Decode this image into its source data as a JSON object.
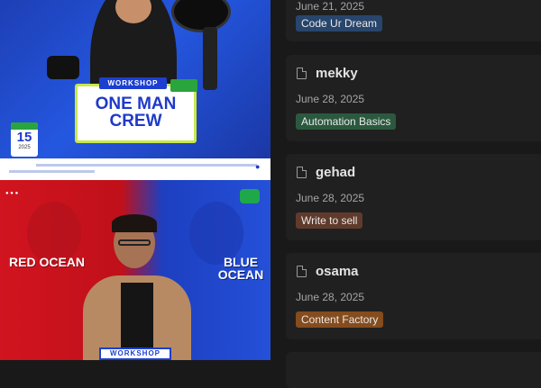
{
  "gallery": {
    "top_poster": {
      "workshop_label": "WORKSHOP",
      "title": "ONE MAN CREW",
      "date_day": "15",
      "date_year": "2025"
    },
    "bottom_poster": {
      "left_heading": "RED OCEAN",
      "right_heading": "BLUE OCEAN",
      "workshop_label": "WORKSHOP"
    }
  },
  "list": {
    "items": [
      {
        "title": "",
        "date": "June 21, 2025",
        "tag": "Code Ur Dream",
        "tag_color": "#28456c"
      },
      {
        "title": "mekky",
        "date": "June 28, 2025",
        "tag": "Automation Basics",
        "tag_color": "#2b593f"
      },
      {
        "title": "gehad",
        "date": "June 28, 2025",
        "tag": "Write to sell",
        "tag_color": "#603b2c"
      },
      {
        "title": "osama",
        "date": "June 28, 2025",
        "tag": "Content Factory",
        "tag_color": "#854c1d"
      }
    ]
  }
}
